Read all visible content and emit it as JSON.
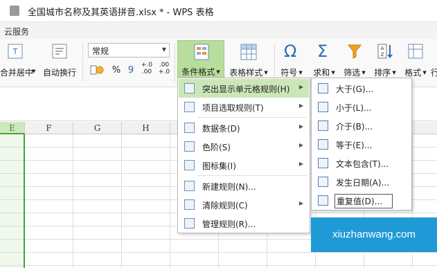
{
  "window": {
    "title": "全国城市名称及其英语拼音.xlsx * - WPS 表格"
  },
  "menubar": {
    "item": "云服务"
  },
  "ribbon": {
    "merge_center": "合并居中",
    "wrap_text": "自动换行",
    "number_format": "常规",
    "percent": "%",
    "comma": "9",
    "inc_decimal": "+.0\n.00",
    "dec_decimal": ".00\n+.0",
    "conditional_format": "条件格式",
    "table_style": "表格样式",
    "symbol": "符号",
    "sum": "求和",
    "filter": "筛选",
    "sort": "排序",
    "format": "格式",
    "overflow": "行"
  },
  "columns": [
    "E",
    "F",
    "G",
    "H"
  ],
  "menu": {
    "items": [
      {
        "label": "突出显示单元格规则(H)",
        "icon": "highlight-rules-icon",
        "has_submenu": true,
        "highlighted": true
      },
      {
        "label": "项目选取规则(T)",
        "icon": "top-bottom-rules-icon",
        "has_submenu": true
      },
      {
        "label": "数据条(D)",
        "icon": "data-bars-icon",
        "has_submenu": true
      },
      {
        "label": "色阶(S)",
        "icon": "color-scales-icon",
        "has_submenu": true
      },
      {
        "label": "图标集(I)",
        "icon": "icon-sets-icon",
        "has_submenu": true
      },
      {
        "label": "新建规则(N)...",
        "icon": "new-rule-icon",
        "has_submenu": false
      },
      {
        "label": "清除规则(C)",
        "icon": "clear-rules-icon",
        "has_submenu": true
      },
      {
        "label": "管理规则(R)...",
        "icon": "manage-rules-icon",
        "has_submenu": false
      }
    ]
  },
  "submenu": {
    "items": [
      {
        "label": "大于(G)...",
        "icon": "greater-than-icon"
      },
      {
        "label": "小于(L)...",
        "icon": "less-than-icon"
      },
      {
        "label": "介于(B)...",
        "icon": "between-icon"
      },
      {
        "label": "等于(E)...",
        "icon": "equal-to-icon"
      },
      {
        "label": "文本包含(T)...",
        "icon": "text-contains-icon"
      },
      {
        "label": "发生日期(A)...",
        "icon": "date-occurring-icon"
      },
      {
        "label": "重复值(D)...",
        "icon": "duplicate-values-icon"
      }
    ]
  },
  "watermark": "xiuzhanwang.com",
  "colors": {
    "accent_green": "#3fa535",
    "highlight": "#cbe6b7",
    "watermark_bg": "#1f9ad6"
  }
}
